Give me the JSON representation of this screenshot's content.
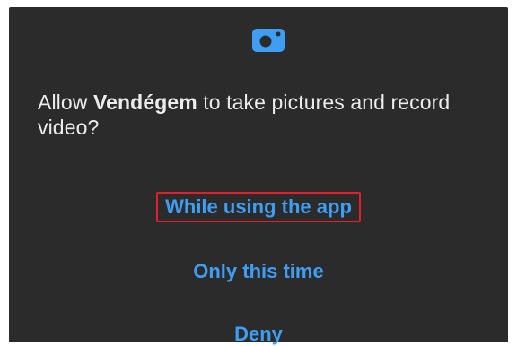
{
  "dialog": {
    "icon": "camera-icon",
    "prompt_prefix": "Allow ",
    "app_name": "Vendégem",
    "prompt_suffix": " to take pictures and record video?",
    "options": [
      {
        "label": "While using the app",
        "highlighted": true
      },
      {
        "label": "Only this time"
      },
      {
        "label": "Deny"
      }
    ]
  },
  "colors": {
    "dialog_background": "#2b2b2b",
    "text": "#ececec",
    "accent": "#3f9ef3",
    "highlight_border": "#e2202d"
  }
}
